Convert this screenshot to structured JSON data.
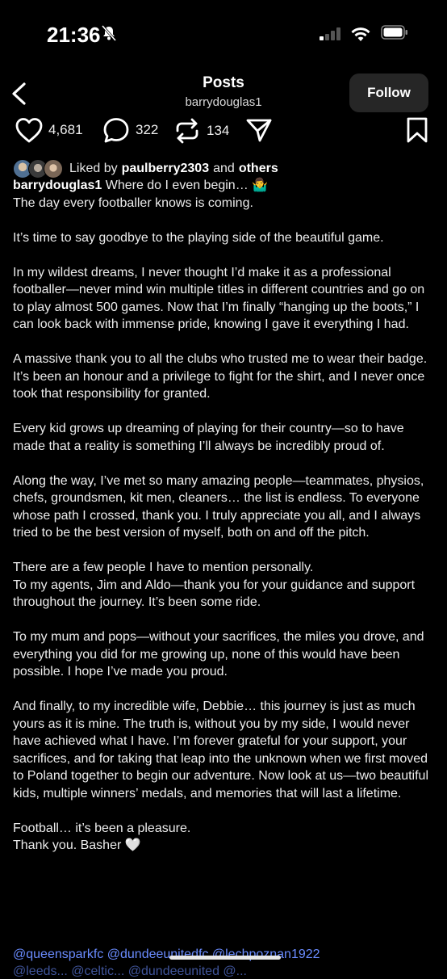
{
  "status": {
    "time": "21:36",
    "icons": [
      "bell-slash-icon",
      "signal-icon",
      "wifi-icon",
      "battery-icon"
    ]
  },
  "header": {
    "title": "Posts",
    "subtitle": "barrydouglas1",
    "follow_label": "Follow"
  },
  "actions": {
    "likes": "4,681",
    "comments": "322",
    "reposts": "134"
  },
  "liked_by": {
    "prefix": "Liked by",
    "user": "paulberry2303",
    "joiner": "and",
    "others": "others"
  },
  "caption": {
    "user": "barrydouglas1",
    "first_line": " Where do I even begin… 🤷‍♂️",
    "paragraphs": [
      "The day every footballer knows is coming.",
      "It’s time to say goodbye to the playing side of the beautiful game.",
      "In my wildest dreams, I never thought I’d make it as a professional footballer—never mind win multiple titles in different countries and go on to play almost 500 games. Now that I’m finally “hanging up the boots,” I can look back with immense pride, knowing I gave it everything I had.",
      "A massive thank you to all the clubs who trusted me to wear their badge. It’s been an honour and a privilege to fight for the shirt, and I never once took that responsibility for granted.",
      "Every kid grows up dreaming of playing for their country—so to have made that a reality is something I’ll always be incredibly proud of.",
      "Along the way, I’ve met so many amazing people—teammates, physios, chefs, groundsmen, kit men, cleaners… the list is endless. To everyone whose path I crossed, thank you. I truly appreciate you all, and I always tried to be the best version of myself, both on and off the pitch.",
      "There are a few people I have to mention personally.\nTo my agents, Jim and Aldo—thank you for your guidance and support throughout the journey. It’s been some ride.",
      "To my mum and pops—without your sacrifices, the miles you drove, and everything you did for me growing up, none of this would have been possible. I hope I’ve made you proud.",
      "And finally, to my incredible wife, Debbie… this journey is just as much yours as it is mine. The truth is, without you by my side, I would never have achieved what I have. I’m forever grateful for your support, your sacrifices, and for taking that leap into the unknown when we first moved to Poland together to begin our adventure. Now look at us—two beautiful kids, multiple winners’ medals, and memories that will last a lifetime.",
      "Football… it’s been a pleasure.\nThank you. Basher 🤍"
    ],
    "tags_line": "@queensparkfc @dundeeunitedfc @lechpoznan1922",
    "tags_line2": "@leeds... @celtic... @dundeeunited @..."
  }
}
